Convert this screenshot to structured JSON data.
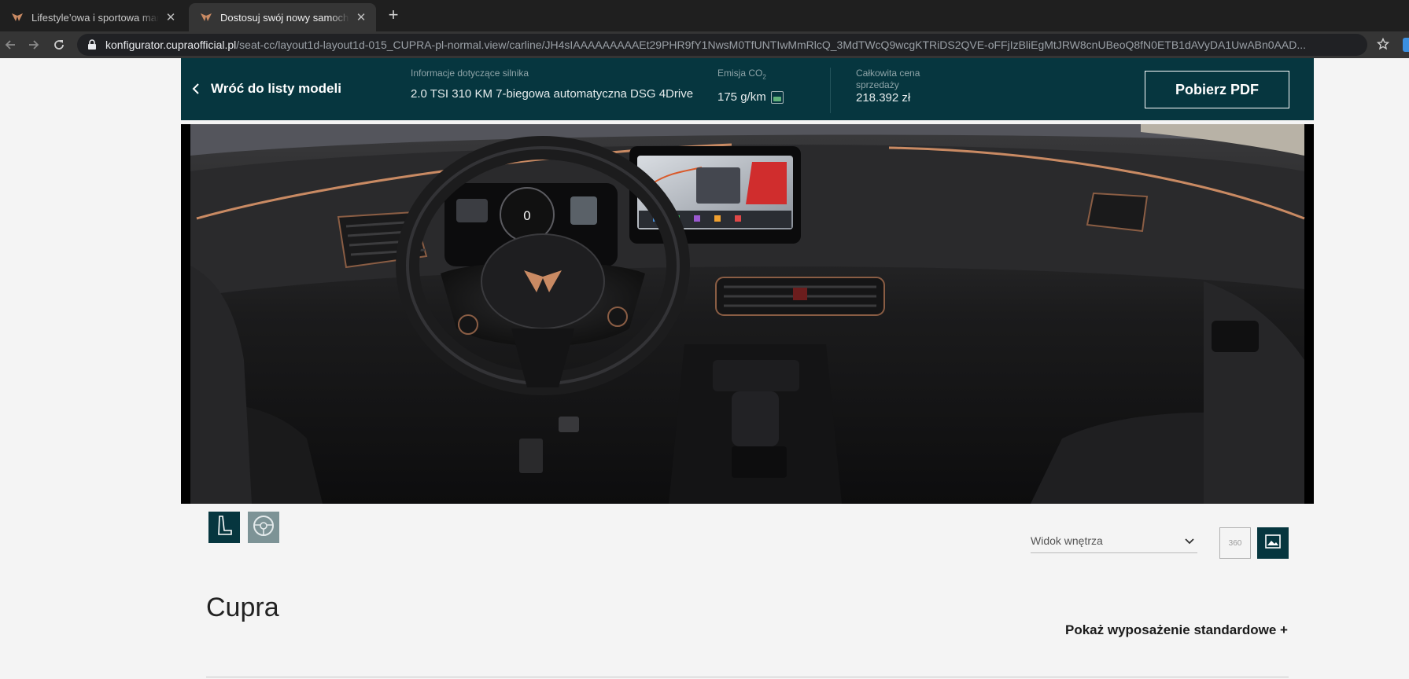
{
  "browser": {
    "tabs": [
      {
        "title": "Lifestyle’owa i sportowa marka",
        "active": false
      },
      {
        "title": "Dostosuj swój nowy samochód",
        "active": true
      }
    ],
    "url_host": "konfigurator.cupraofficial.pl",
    "url_path": "/seat-cc/layout1d-layout1d-015_CUPRA-pl-normal.view/carline/JH4sIAAAAAAAAAEt29PHR9fY1NwsM0TfUNTIwMmRlcQ_3MdTWcQ9wcgKTRiDS2QVE-oFFjIzBliEgMtJRW8cnUBeoQ8fN0ETB1dAVyDA1UwABn0AAD..."
  },
  "header": {
    "back_label": "Wróć do listy modeli",
    "engine_label": "Informacje dotyczące silnika",
    "engine_value": "2.0 TSI 310 KM 7-biegowa automatyczna DSG 4Drive",
    "emission_label_prefix": "Emisja CO",
    "emission_label_sub": "2",
    "emission_value": "175 g/km",
    "price_label": "Całkowita cena sprzedaży",
    "price_value": "218.392 zł",
    "pdf_button": "Pobierz PDF"
  },
  "viewer": {
    "view_select_value": "Widok wnętrza",
    "view_360_label": "360"
  },
  "model": {
    "title": "Cupra",
    "standard_equipment_link": "Pokaż wyposażenie standardowe +"
  },
  "colors": {
    "brand_petrol": "#06363f",
    "copper_accent": "#c98a63"
  }
}
